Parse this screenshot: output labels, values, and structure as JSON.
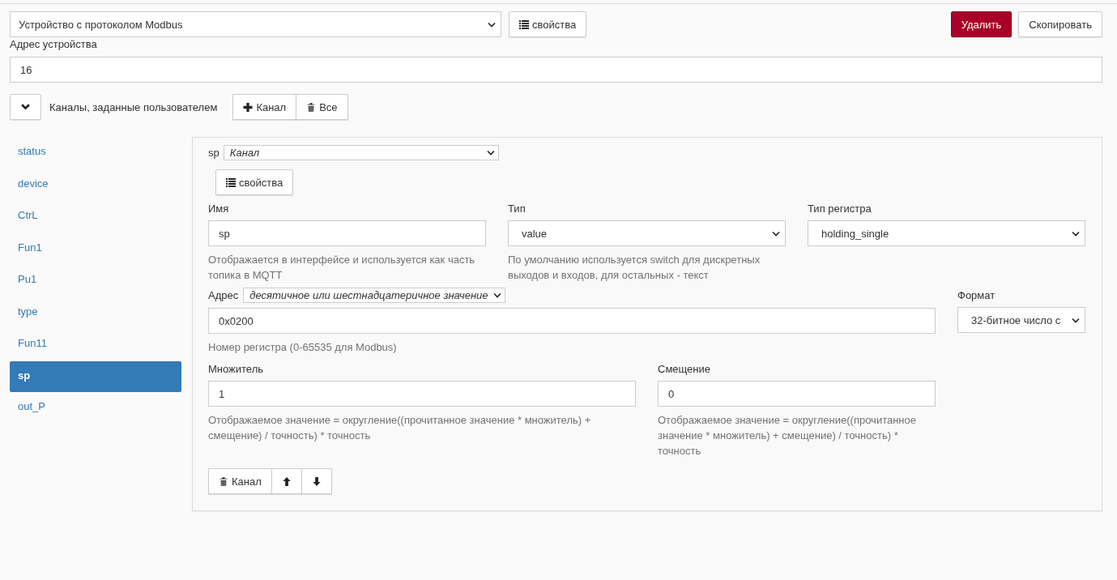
{
  "device": {
    "protocol_select": "Устройство с протоколом Modbus",
    "properties_button": "свойства",
    "delete_button": "Удалить",
    "copy_button": "Скопировать",
    "address_label": "Адрес устройства",
    "address_value": "16"
  },
  "channels_header": {
    "expanded": true,
    "title": "Каналы, заданные пользователем",
    "add_button": "Канал",
    "delete_all_button": "Все"
  },
  "sidebar": {
    "items": [
      {
        "label": "status",
        "selected": false
      },
      {
        "label": "device",
        "selected": false
      },
      {
        "label": "CtrL",
        "selected": false
      },
      {
        "label": "Fun1",
        "selected": false
      },
      {
        "label": "Pu1",
        "selected": false
      },
      {
        "label": "type",
        "selected": false
      },
      {
        "label": "Fun11",
        "selected": false
      },
      {
        "label": "sp",
        "selected": true
      },
      {
        "label": "out_P",
        "selected": false
      }
    ]
  },
  "channel": {
    "title": "sp",
    "kind_select": "Канал",
    "properties_button": "свойства",
    "name": {
      "label": "Имя",
      "value": "sp",
      "help": "Отображается в интерфейсе и используется как часть топика в MQTT"
    },
    "type": {
      "label": "Тип",
      "value": "value",
      "help": "По умолчанию используется switch для дискретных выходов и входов, для остальных - текст"
    },
    "reg_type": {
      "label": "Тип регистра",
      "value": "holding_single"
    },
    "address": {
      "label": "Адрес",
      "mode_select": "десятичное или шестнадцатеричное значение",
      "value": "0x0200",
      "help": "Номер регистра (0-65535 для Modbus)"
    },
    "format": {
      "label": "Формат",
      "value": "32-битное число с"
    },
    "scale": {
      "label": "Множитель",
      "value": "1",
      "help": "Отображаемое значение = округление((прочитанное значение * множитель) + смещение) / точность) * точность"
    },
    "offset": {
      "label": "Смещение",
      "value": "0",
      "help": "Отображаемое значение = округление((прочитанное значение * множитель) + смещение) / точность) * точность"
    },
    "delete_button": "Канал"
  }
}
